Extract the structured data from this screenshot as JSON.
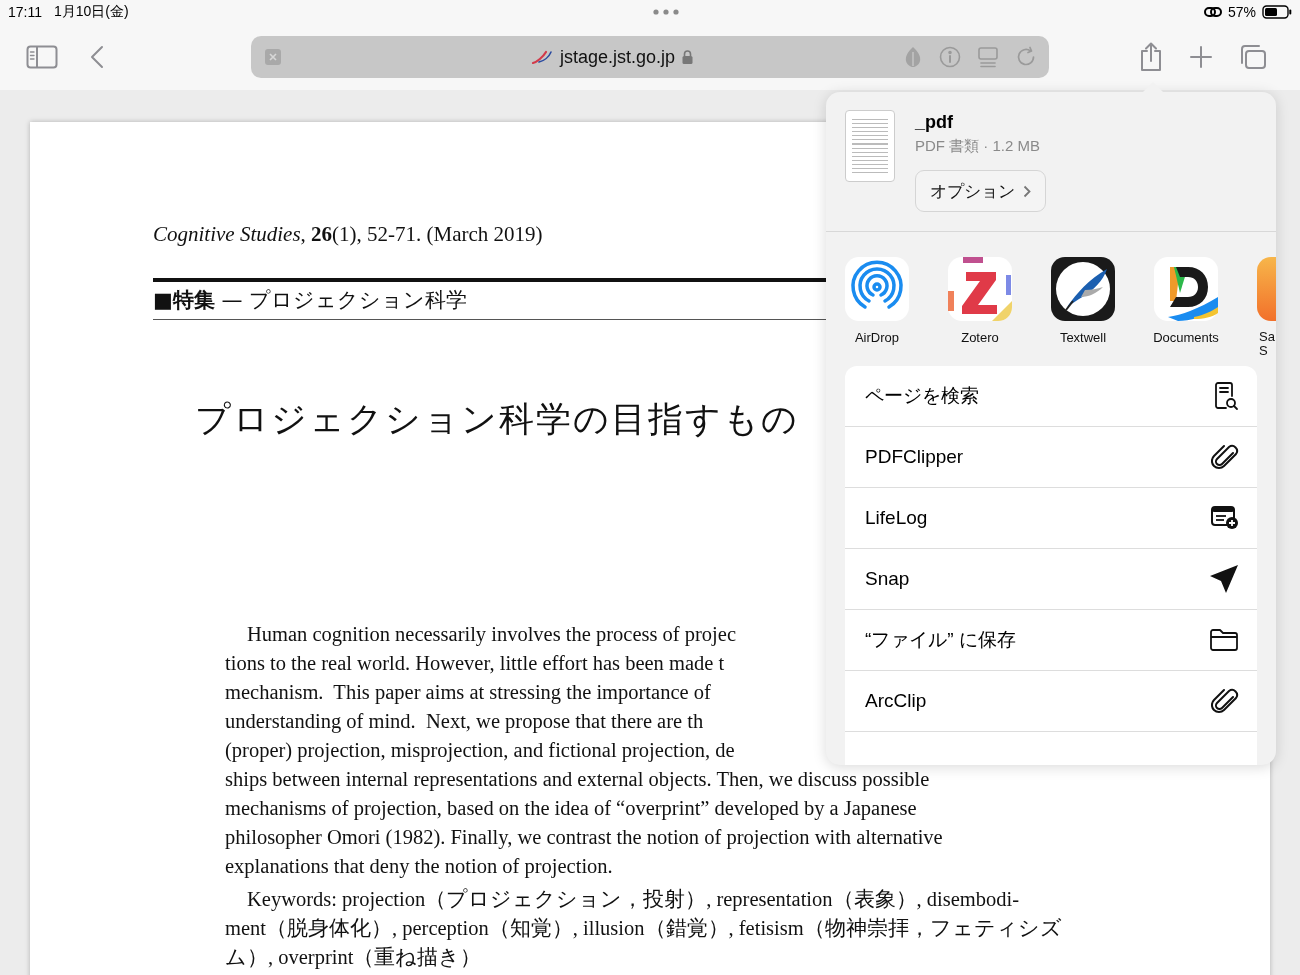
{
  "status_bar": {
    "time": "17:11",
    "date": "1月10日(金)",
    "battery_percent": "57%"
  },
  "toolbar": {
    "url": "jstage.jst.go.jp"
  },
  "document": {
    "citation": "*Cognitive Studies*, **26**(1), 52-71. (March 2019)",
    "section": "**■特集** — プロジェクション科学",
    "title": "プロジェクション科学の目指すもの",
    "abstract_lines": [
      "Human cognition necessarily involves the process of projec",
      "tions to the real world. However, little effort has been made t",
      "mechanism.  This paper aims at stressing the importance of",
      "understanding of mind.  Next, we propose that there are th",
      "(proper) projection, misprojection, and fictional projection, de",
      "ships between internal representations and external objects. Then, we discuss possible",
      "mechanisms of projection, based on the idea of “overprint” developed by a Japanese",
      "philosopher Omori (1982). Finally, we contrast the notion of projection with alternative",
      "explanations that deny the notion of projection."
    ],
    "keywords_lines": [
      "Keywords: projection（プロジェクション，投射）, representation（表象）, disembodi-",
      "ment（脱身体化）, perception（知覚）, illusion（錯覚）, fetisism（物神崇拝，フェティシズ",
      "ム）, overprint（重ね描き）"
    ]
  },
  "share_sheet": {
    "file_name": "_pdf",
    "file_info": "PDF 書類 · 1.2 MB",
    "options_button": "オプション",
    "apps": [
      {
        "name": "AirDrop"
      },
      {
        "name": "Zotero"
      },
      {
        "name": "Textwell"
      },
      {
        "name": "Documents"
      },
      {
        "name": "Sa S"
      }
    ],
    "actions": [
      {
        "label": "ページを検索"
      },
      {
        "label": "PDFClipper"
      },
      {
        "label": "LifeLog"
      },
      {
        "label": "Snap"
      },
      {
        "label": "“ファイル” に保存"
      },
      {
        "label": "ArcClip"
      }
    ]
  }
}
